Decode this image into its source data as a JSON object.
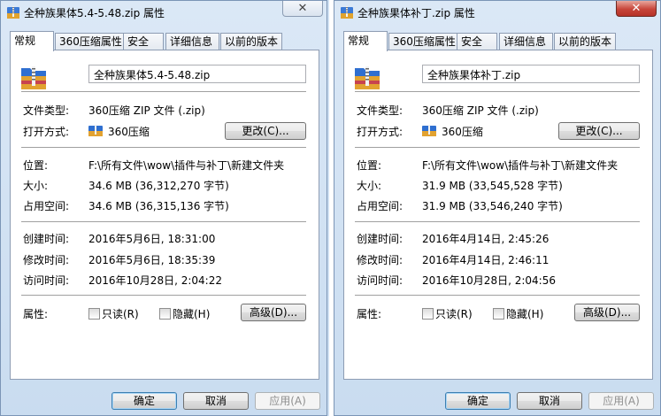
{
  "dialogs": [
    {
      "title": "全种族果体5.4-5.48.zip 属性",
      "close_glyph": "✕",
      "tabs": [
        "常规",
        "360压缩属性",
        "安全",
        "详细信息",
        "以前的版本"
      ],
      "file_name": "全种族果体5.4-5.48.zip",
      "file_type_label": "文件类型:",
      "file_type_value": "360压缩 ZIP 文件 (.zip)",
      "open_with_label": "打开方式:",
      "open_with_value": "360压缩",
      "change_button": "更改(C)...",
      "location_label": "位置:",
      "location_value": "F:\\所有文件\\wow\\插件与补丁\\新建文件夹",
      "size_label": "大小:",
      "size_value": "34.6 MB (36,312,270 字节)",
      "disk_size_label": "占用空间:",
      "disk_size_value": "34.6 MB (36,315,136 字节)",
      "created_label": "创建时间:",
      "created_value": "2016年5月6日, 18:31:00",
      "modified_label": "修改时间:",
      "modified_value": "2016年5月6日, 18:35:39",
      "accessed_label": "访问时间:",
      "accessed_value": "2016年10月28日, 2:04:22",
      "attributes_label": "属性:",
      "readonly_label": "只读(R)",
      "hidden_label": "隐藏(H)",
      "advanced_button": "高级(D)...",
      "ok_button": "确定",
      "cancel_button": "取消",
      "apply_button": "应用(A)"
    },
    {
      "title": "全种族果体补丁.zip 属性",
      "close_glyph": "✕",
      "tabs": [
        "常规",
        "360压缩属性",
        "安全",
        "详细信息",
        "以前的版本"
      ],
      "file_name": "全种族果体补丁.zip",
      "file_type_label": "文件类型:",
      "file_type_value": "360压缩 ZIP 文件 (.zip)",
      "open_with_label": "打开方式:",
      "open_with_value": "360压缩",
      "change_button": "更改(C)...",
      "location_label": "位置:",
      "location_value": "F:\\所有文件\\wow\\插件与补丁\\新建文件夹",
      "size_label": "大小:",
      "size_value": "31.9 MB (33,545,528 字节)",
      "disk_size_label": "占用空间:",
      "disk_size_value": "31.9 MB (33,546,240 字节)",
      "created_label": "创建时间:",
      "created_value": "2016年4月14日, 2:45:26",
      "modified_label": "修改时间:",
      "modified_value": "2016年4月14日, 2:46:11",
      "accessed_label": "访问时间:",
      "accessed_value": "2016年10月28日, 2:04:56",
      "attributes_label": "属性:",
      "readonly_label": "只读(R)",
      "hidden_label": "隐藏(H)",
      "advanced_button": "高级(D)...",
      "ok_button": "确定",
      "cancel_button": "取消",
      "apply_button": "应用(A)"
    }
  ]
}
